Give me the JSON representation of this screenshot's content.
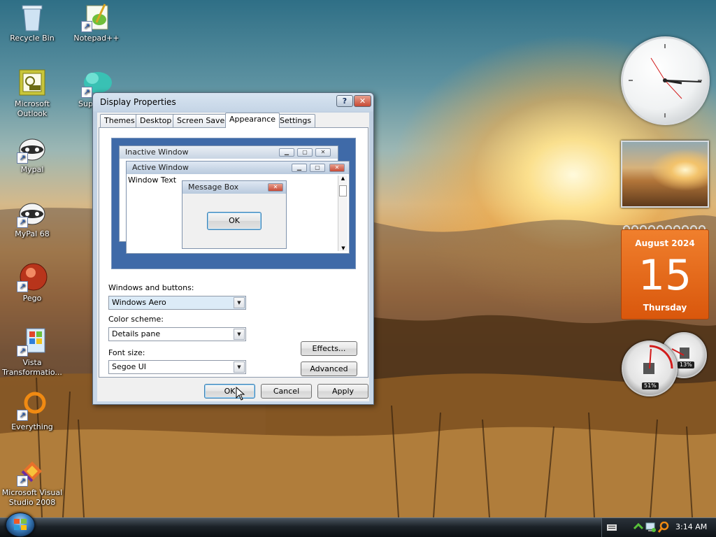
{
  "desktop_icons": [
    {
      "label_lines": [
        "Recycle Bin"
      ],
      "icon": "recycle-bin-icon"
    },
    {
      "label_lines": [
        "Notepad++"
      ],
      "icon": "notepad-plus-plus-icon"
    },
    {
      "label_lines": [
        "Microsoft",
        "Outlook"
      ],
      "icon": "outlook-icon"
    },
    {
      "label_lines": [
        "Supe"
      ],
      "icon": "cloud-app-icon"
    },
    {
      "label_lines": [
        "Mypal"
      ],
      "icon": "mypal-icon"
    },
    {
      "label_lines": [
        "MyPal 68"
      ],
      "icon": "mypal-68-icon"
    },
    {
      "label_lines": [
        "Pego"
      ],
      "icon": "pego-icon"
    },
    {
      "label_lines": [
        "Vista",
        "Transformatio..."
      ],
      "icon": "vista-transformation-icon"
    },
    {
      "label_lines": [
        "Everything"
      ],
      "icon": "everything-icon"
    },
    {
      "label_lines": [
        "Microsoft Visual",
        "Studio 2008"
      ],
      "icon": "visual-studio-icon"
    }
  ],
  "window": {
    "title": "Display Properties",
    "help_glyph": "?",
    "close_glyph": "✕",
    "tabs": [
      "Themes",
      "Desktop",
      "Screen Saver",
      "Appearance",
      "Settings"
    ],
    "active_tab": "Appearance",
    "preview": {
      "inactive_title": "Inactive Window",
      "active_title": "Active Window",
      "window_text": "Window Text",
      "message_box_title": "Message Box",
      "ok_label": "OK"
    },
    "windows_and_buttons": {
      "label": "Windows and buttons:",
      "value": "Windows Aero"
    },
    "color_scheme": {
      "label": "Color scheme:",
      "value": "Details pane"
    },
    "font_size": {
      "label": "Font size:",
      "value": "Segoe UI"
    },
    "effects_label": "Effects...",
    "advanced_label": "Advanced",
    "ok_label": "OK",
    "cancel_label": "Cancel",
    "apply_label": "Apply"
  },
  "gadgets": {
    "calendar": {
      "month_year": "August 2024",
      "day": "15",
      "weekday": "Thursday"
    },
    "cpu_meter": {
      "cpu": "51%",
      "memory": "13%"
    }
  },
  "taskbar": {
    "time": "3:14 AM"
  },
  "colors": {
    "accent": "#3c7fb1",
    "calendar": "#e8661a",
    "titlebar": "#c5d5e6"
  }
}
